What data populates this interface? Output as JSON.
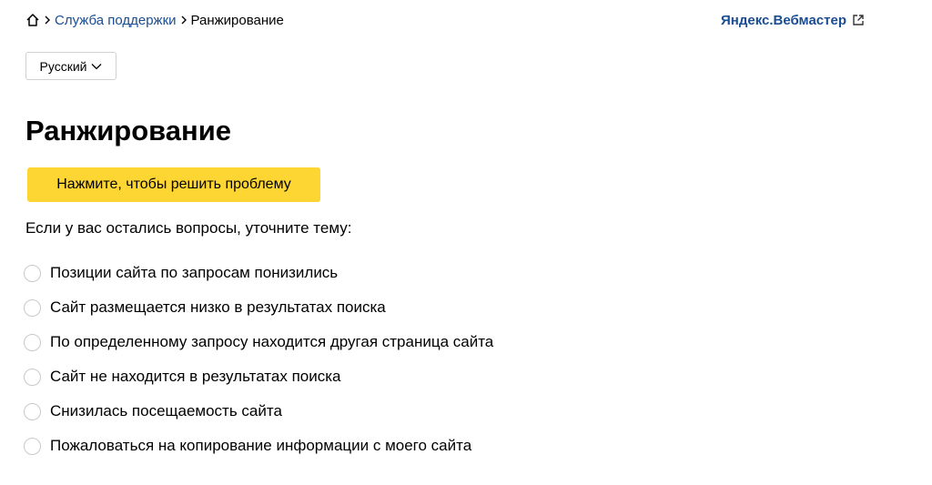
{
  "breadcrumb": {
    "home_icon": "home-icon",
    "separator_icon": "chevron-right-icon",
    "support_link": "Служба поддержки",
    "current": "Ранжирование"
  },
  "header": {
    "service_link": "Яндекс.Вебмастер",
    "service_icon": "external-link-icon"
  },
  "language": {
    "selected": "Русский",
    "icon": "chevron-down-icon"
  },
  "main": {
    "title": "Ранжирование",
    "solve_button": "Нажмите, чтобы решить проблему",
    "prompt": "Если у вас остались вопросы, уточните тему:",
    "topics": [
      "Позиции сайта по запросам понизились",
      "Сайт размещается низко в результатах поиска",
      "По определенному запросу находится другая страница сайта",
      "Сайт не находится в результатах поиска",
      "Снизилась посещаемость сайта",
      "Пожаловаться на копирование информации с моего сайта"
    ]
  },
  "colors": {
    "link": "#1a4d91",
    "button": "#fed633",
    "radio_border": "#c8c8c8"
  }
}
